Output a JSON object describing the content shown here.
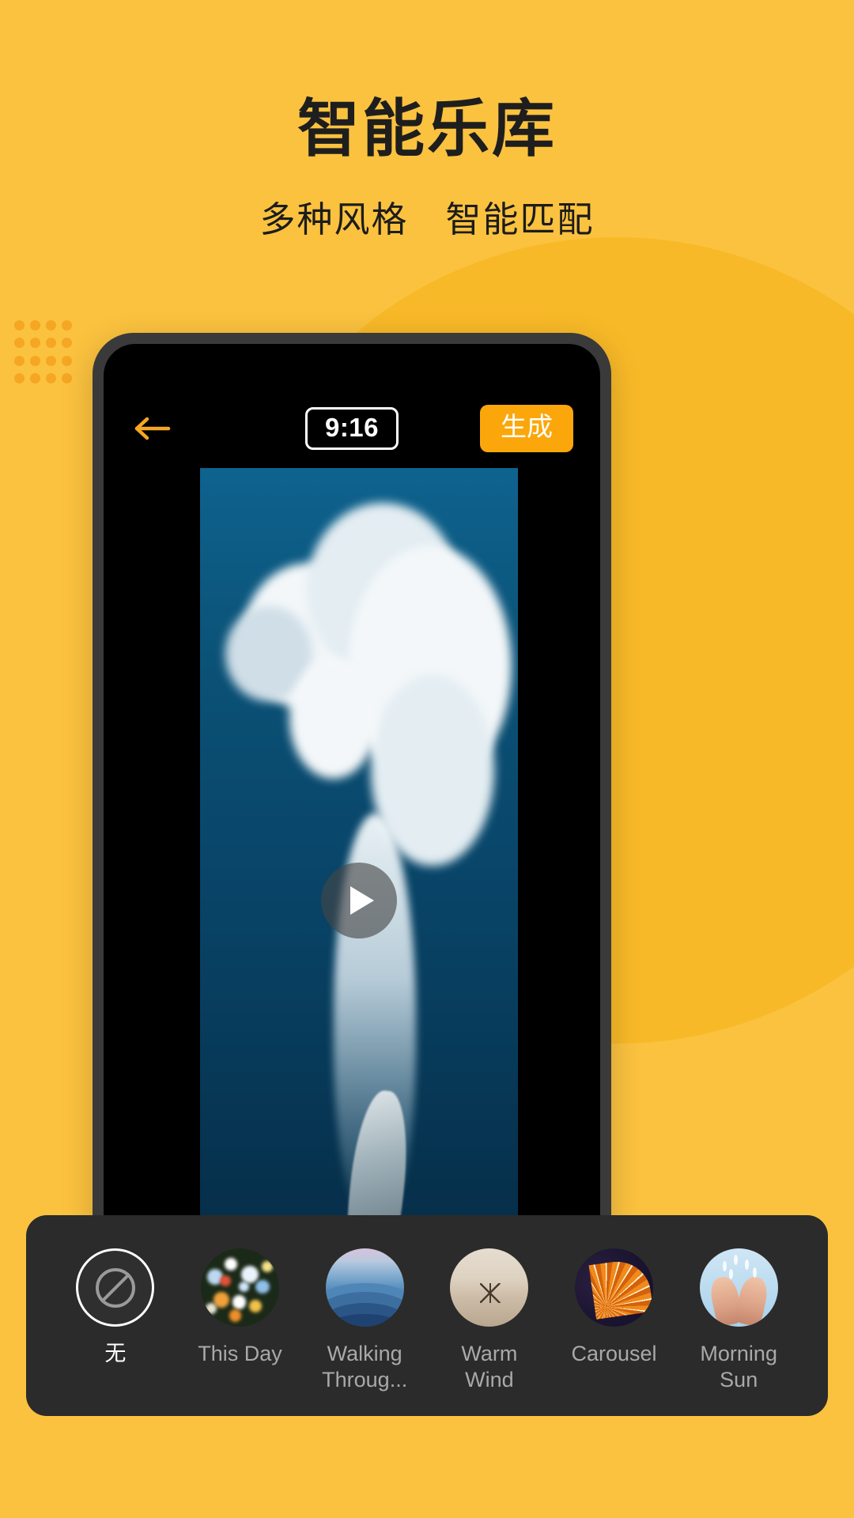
{
  "page": {
    "title": "智能乐库",
    "subtitle": "多种风格　智能匹配",
    "background_color": "#FBC23F",
    "accent_color": "#FBA70B",
    "title_color": "#1E1E1E"
  },
  "phone": {
    "toolbar": {
      "back_icon": "arrow-left-icon",
      "aspect_ratio_badge": "9:16",
      "generate_label": "生成"
    },
    "preview": {
      "play_icon": "play-icon",
      "description": "underwater diver with splash"
    }
  },
  "style_panel": {
    "items": [
      {
        "label": "无",
        "thumb": "none-icon",
        "selected": true
      },
      {
        "label": "This Day",
        "thumb": "bokeh-lights",
        "selected": false
      },
      {
        "label": "Walking Throug...",
        "thumb": "blue-mountains",
        "selected": false
      },
      {
        "label": "Warm Wind",
        "thumb": "sand-dune",
        "selected": false
      },
      {
        "label": "Carousel",
        "thumb": "ferris-wheel",
        "selected": false
      },
      {
        "label": "Morning Sun",
        "thumb": "hands-water",
        "selected": false
      }
    ]
  }
}
